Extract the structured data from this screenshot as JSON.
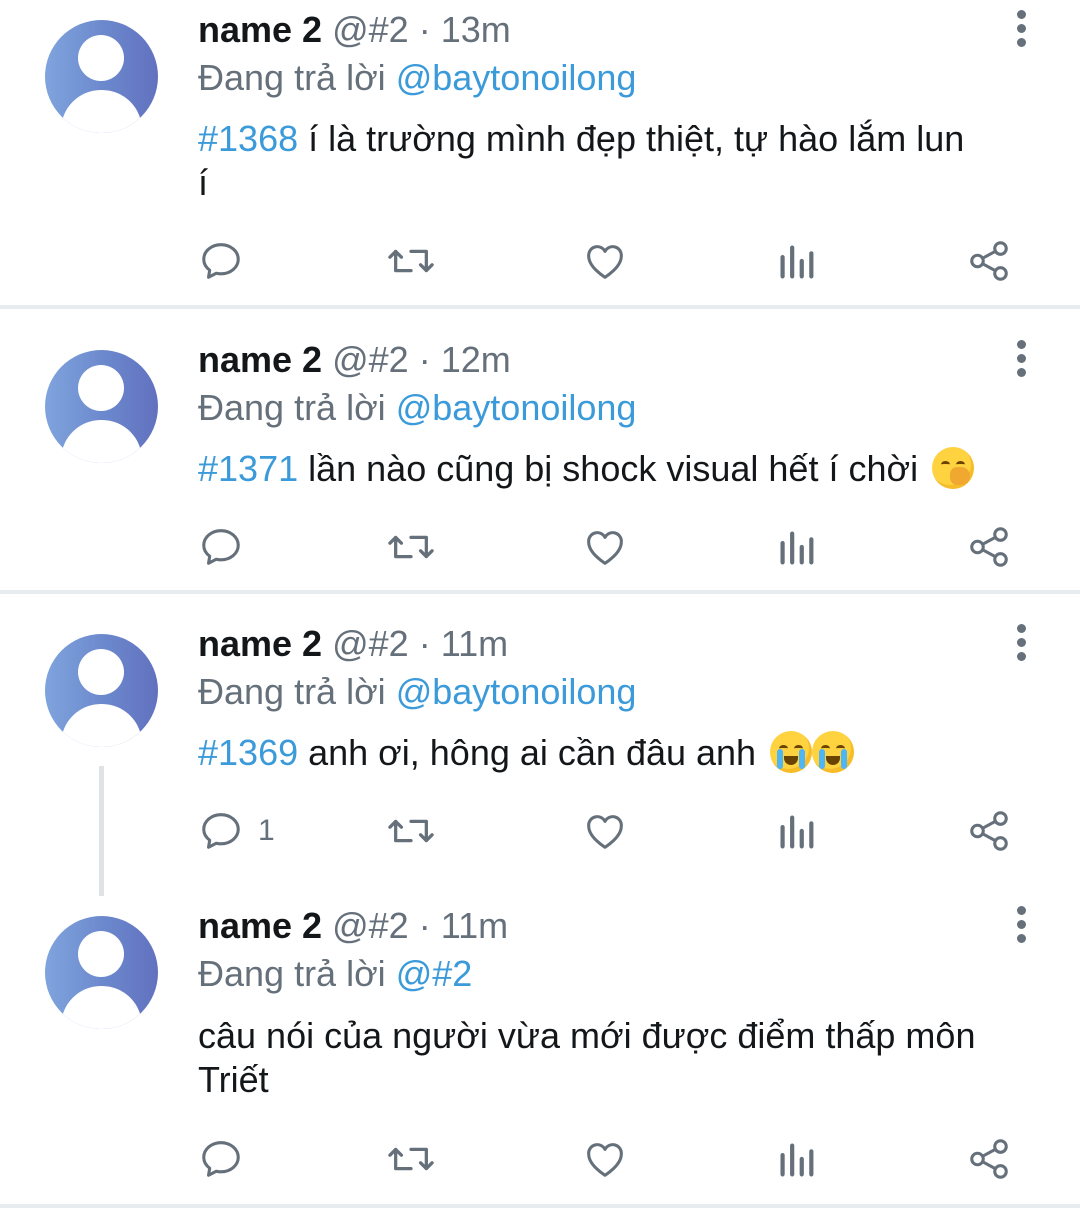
{
  "tweets": [
    {
      "name": "name 2",
      "handle": "@#2",
      "sep": "·",
      "time": "13m",
      "reply_prefix": "Đang trả lời",
      "reply_to": "@baytonoilong",
      "tag": "#1368",
      "text": " í là trường mình đẹp thiệt, tự hào lắm lun",
      "text_line2": "í",
      "reply_count": ""
    },
    {
      "name": "name 2",
      "handle": "@#2",
      "sep": "·",
      "time": "12m",
      "reply_prefix": "Đang trả lời",
      "reply_to": "@baytonoilong",
      "tag": "#1371",
      "text": " lần nào cũng bị shock visual hết í chời",
      "emoji": "smirk-hand-over-mouth",
      "reply_count": ""
    },
    {
      "name": "name 2",
      "handle": "@#2",
      "sep": "·",
      "time": "11m",
      "reply_prefix": "Đang trả lời",
      "reply_to": "@baytonoilong",
      "tag": "#1369",
      "text": " anh ơi, hông ai cần đâu anh",
      "emoji": "loudly-crying-face x2",
      "reply_count": "1"
    },
    {
      "name": "name 2",
      "handle": "@#2",
      "sep": "·",
      "time": "11m",
      "reply_prefix": "Đang trả lời",
      "reply_to": "@#2",
      "text": "câu nói của người vừa mới được điểm thấp môn",
      "text_line2": "Triết",
      "reply_count": ""
    }
  ],
  "icons": {
    "reply": "reply-icon",
    "retweet": "retweet-icon",
    "like": "heart-icon",
    "stats": "stats-icon",
    "share": "share-icon",
    "more": "more-vertical-icon"
  },
  "colors": {
    "link": "#3b9ad9",
    "muted": "#65707b",
    "divider": "#e6ecf0",
    "avatar_gradient": [
      "#7fa4dd",
      "#6271bf"
    ]
  }
}
